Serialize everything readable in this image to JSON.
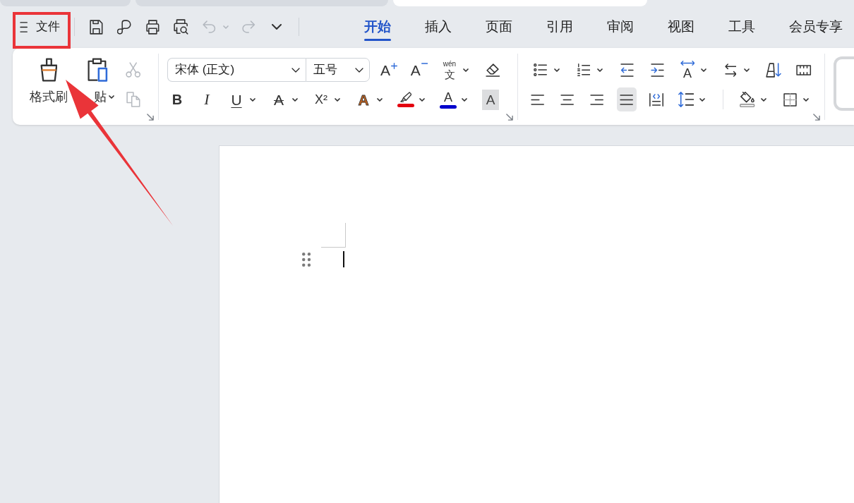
{
  "doc_tabs": [
    {
      "selected": false
    },
    {
      "selected": false
    },
    {
      "selected": true
    }
  ],
  "quick_bar": {
    "menu": {
      "label": "文件"
    },
    "tools": [
      {
        "kind": "save",
        "disabled": false,
        "dropdown": false
      },
      {
        "kind": "loop",
        "disabled": false,
        "dropdown": false
      },
      {
        "kind": "print",
        "disabled": false,
        "dropdown": false
      },
      {
        "kind": "print_preview",
        "disabled": false,
        "dropdown": false
      },
      {
        "kind": "undo",
        "disabled": true,
        "dropdown": true
      },
      {
        "kind": "redo",
        "disabled": true,
        "dropdown": false
      },
      {
        "kind": "more",
        "disabled": false,
        "dropdown": false
      }
    ]
  },
  "tabs": [
    {
      "label": "开始",
      "selected": true
    },
    {
      "label": "插入",
      "selected": false
    },
    {
      "label": "页面",
      "selected": false
    },
    {
      "label": "引用",
      "selected": false
    },
    {
      "label": "审阅",
      "selected": false
    },
    {
      "label": "视图",
      "selected": false
    },
    {
      "label": "工具",
      "selected": false
    },
    {
      "label": "会员专享",
      "selected": false
    }
  ],
  "ribbon": {
    "groups": [
      {
        "kind": "clipboard",
        "large": [
          {
            "kind": "format_painter",
            "label": "格式刷",
            "dropdown": false
          },
          {
            "kind": "paste",
            "label": "贴",
            "dropdown": true
          }
        ],
        "small": [
          {
            "kind": "cut",
            "disabled": true,
            "dropdown": false
          },
          {
            "kind": "copy",
            "disabled": true,
            "dropdown": false
          }
        ],
        "launcher": true
      },
      {
        "kind": "font",
        "font_family": {
          "value": "宋体 (正文)"
        },
        "font_size": {
          "value": "五号"
        },
        "top_row": [
          {
            "kind": "grow_font",
            "glyph": "A",
            "dropdown": false
          },
          {
            "kind": "shrink_font",
            "glyph": "A",
            "dropdown": false
          },
          {
            "kind": "pinyin",
            "ruby": "wén",
            "glyph": "文",
            "dropdown": true
          },
          {
            "kind": "clear_format",
            "dropdown": false
          }
        ],
        "bottom_row": [
          {
            "kind": "bold",
            "glyph": "B",
            "dropdown": false
          },
          {
            "kind": "italic",
            "glyph": "I",
            "dropdown": false
          },
          {
            "kind": "underline",
            "glyph": "U",
            "dropdown": true
          },
          {
            "kind": "strikethrough",
            "glyph": "A",
            "dropdown": true
          },
          {
            "kind": "superscript",
            "glyph": "X²",
            "dropdown": true
          },
          {
            "kind": "text_effect",
            "glyph": "A",
            "dropdown": true
          },
          {
            "kind": "highlight",
            "color": "#e3000f",
            "dropdown": true
          },
          {
            "kind": "font_color",
            "glyph": "A",
            "color": "#0000cc",
            "dropdown": true
          },
          {
            "kind": "char_shading",
            "glyph": "A",
            "dropdown": false
          }
        ],
        "launcher": true
      },
      {
        "kind": "paragraph",
        "top_row": [
          {
            "kind": "bullets",
            "dropdown": true
          },
          {
            "kind": "numbering",
            "dropdown": true
          },
          {
            "kind": "indent_decrease",
            "dropdown": false
          },
          {
            "kind": "indent_increase",
            "dropdown": false
          },
          {
            "kind": "char_spacing",
            "glyph": "A",
            "dropdown": true
          },
          {
            "kind": "direction",
            "dropdown": true
          },
          {
            "kind": "sort",
            "dropdown": false
          },
          {
            "kind": "ruler",
            "dropdown": false
          }
        ],
        "bottom_row": [
          {
            "kind": "align_left",
            "selected": false,
            "dropdown": false
          },
          {
            "kind": "align_center",
            "selected": false,
            "dropdown": false
          },
          {
            "kind": "align_right",
            "selected": false,
            "dropdown": false
          },
          {
            "kind": "justify",
            "selected": true,
            "dropdown": false
          },
          {
            "kind": "distribute",
            "selected": false,
            "dropdown": false
          },
          {
            "kind": "line_spacing",
            "dropdown": true
          },
          {
            "kind": "separator"
          },
          {
            "kind": "shading",
            "dropdown": true
          },
          {
            "kind": "borders",
            "dropdown": true
          }
        ],
        "launcher": true
      },
      {
        "kind": "styles"
      }
    ]
  },
  "document": {
    "crop_mark": true,
    "paragraph_handle": true,
    "text_cursor": true
  },
  "annotations": {
    "highlight_frame": true,
    "pointer_arrow": true
  }
}
